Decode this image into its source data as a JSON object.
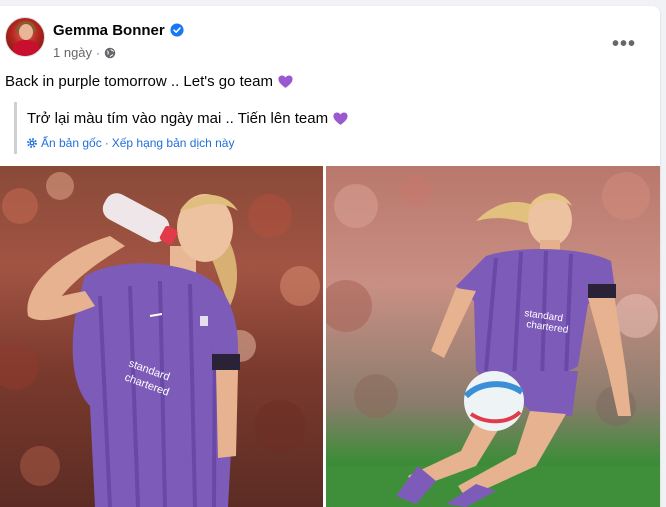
{
  "post": {
    "author": "Gemma Bonner",
    "timestamp": "1 ngày",
    "dot": "·",
    "more_label": "•••",
    "text": "Back in purple tomorrow .. Let's go team",
    "translation": {
      "text": "Trở lại màu tím vào ngày mai .. Tiến lên team",
      "show_original": "Ẩn bản gốc",
      "separator": "·",
      "rate": "Xếp hạng bản dịch này"
    },
    "colors": {
      "verified": "#1877f2",
      "link": "#216fdb",
      "purple_kit": "#7d5bb8",
      "heart": "#9b59d0"
    },
    "photos": [
      {
        "icon": "photo-player-drinking"
      },
      {
        "icon": "photo-player-running-ball"
      }
    ]
  }
}
